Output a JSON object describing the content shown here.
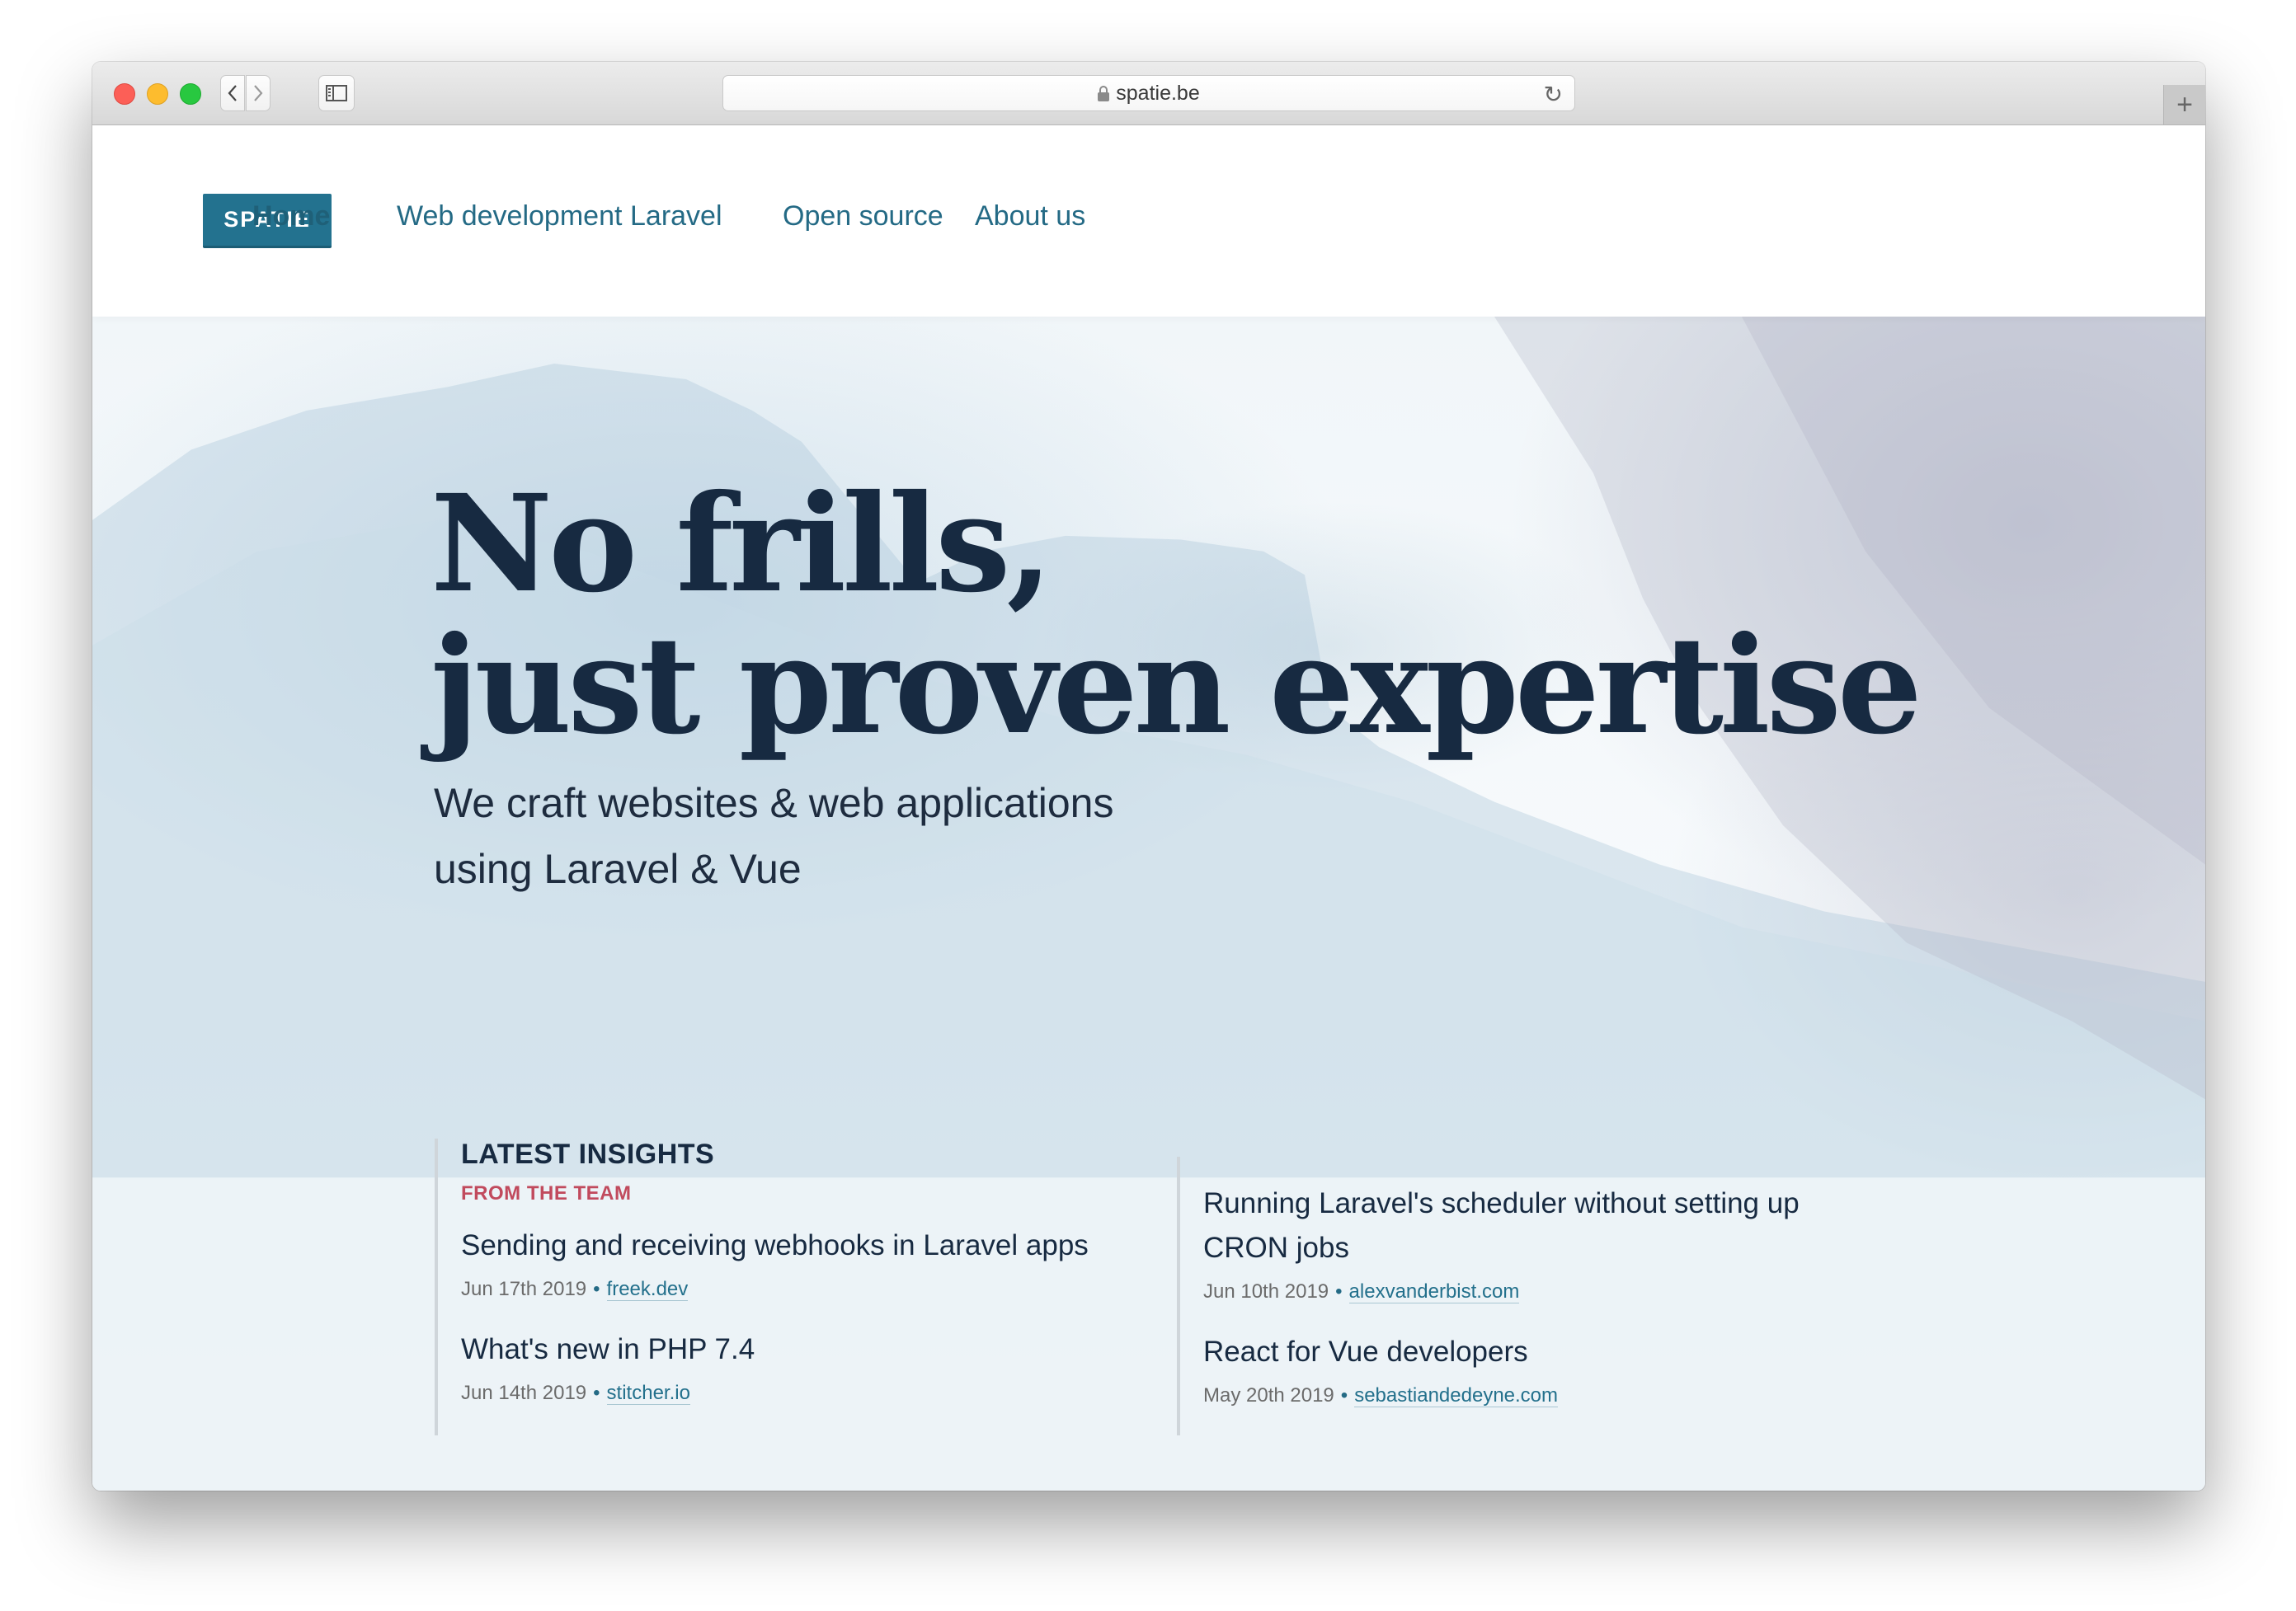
{
  "browser": {
    "url": "spatie.be",
    "icons": {
      "back": "chevron-left-icon",
      "forward": "chevron-right-icon",
      "sidebar": "sidebar-icon",
      "lock": "lock-icon",
      "reload": "reload-icon",
      "new_tab": "plus-icon"
    },
    "reload_glyph": "↻",
    "new_tab_glyph": "+",
    "back_glyph": "‹",
    "forward_glyph": "›"
  },
  "nav": {
    "logo": "SPATIE",
    "items": [
      {
        "label": "Home",
        "active": true
      },
      {
        "label": "Web development",
        "active": false
      },
      {
        "label": "Laravel",
        "active": false
      },
      {
        "label": "Open source",
        "active": false
      },
      {
        "label": "About us",
        "active": false
      }
    ]
  },
  "hero": {
    "headline_line1": "No frills,",
    "headline_line2": "just proven expertise",
    "subhead_line1": "We craft websites & web applications",
    "subhead_line2": "using Laravel & Vue"
  },
  "insights": {
    "title": "LATEST INSIGHTS",
    "subtitle": "FROM THE TEAM",
    "posts": [
      {
        "title": "Sending and receiving webhooks in Laravel apps",
        "date": "Jun 17th 2019",
        "source": "freek.dev"
      },
      {
        "title": "What's new in PHP 7.4",
        "date": "Jun 14th 2019",
        "source": "stitcher.io"
      },
      {
        "title": "Running Laravel's scheduler without setting up CRON jobs",
        "date": "Jun 10th 2019",
        "source": "alexvanderbist.com"
      },
      {
        "title": "React for Vue developers",
        "date": "May 20th 2019",
        "source": "sebastiandedeyne.com"
      }
    ],
    "separator": "•"
  },
  "colors": {
    "brand": "#23728f",
    "nav_link": "#246a85",
    "heading": "#172a41",
    "accent_red": "#c14a5d"
  }
}
